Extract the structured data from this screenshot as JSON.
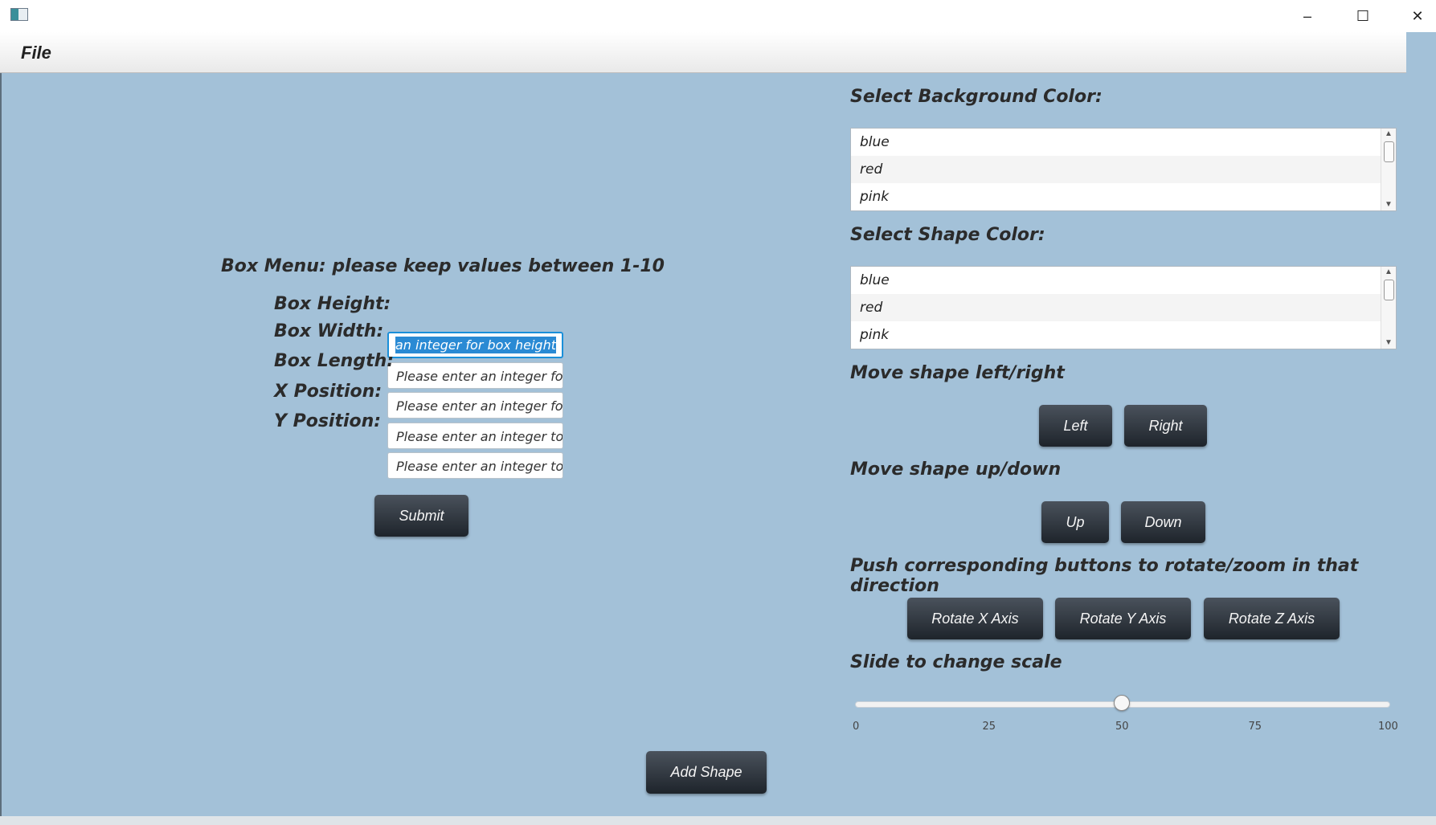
{
  "window": {
    "minimize": "–",
    "maximize": "☐",
    "close": "✕"
  },
  "menu": {
    "file": "File"
  },
  "box_menu": {
    "title": "Box Menu: please keep values between 1-10",
    "fields": [
      {
        "label": "Box Height:",
        "value": "an integer for box height"
      },
      {
        "label": "Box Width:",
        "value": "Please enter an integer fo."
      },
      {
        "label": "Box Length:",
        "value": "Please enter an integer fo."
      },
      {
        "label": "X Position:",
        "value": "Please enter an integer to"
      },
      {
        "label": "Y Position:",
        "value": "Please enter an integer to"
      }
    ],
    "submit": "Submit"
  },
  "add_shape": "Add Shape",
  "background_color": {
    "label": "Select Background Color:",
    "items": [
      "blue",
      "red",
      "pink"
    ]
  },
  "shape_color": {
    "label": "Select Shape Color:",
    "items": [
      "blue",
      "red",
      "pink"
    ]
  },
  "move_lr": {
    "label": "Move shape left/right",
    "left": "Left",
    "right": "Right"
  },
  "move_ud": {
    "label": "Move shape up/down",
    "up": "Up",
    "down": "Down"
  },
  "rotate": {
    "label": "Push corresponding buttons to rotate/zoom in that direction",
    "x": "Rotate X Axis",
    "y": "Rotate Y Axis",
    "z": "Rotate Z Axis"
  },
  "scale": {
    "label": "Slide to change scale",
    "min": 0,
    "max": 100,
    "value": 50,
    "ticks": [
      "0",
      "25",
      "50",
      "75",
      "100"
    ]
  },
  "colors": {
    "content_bg": "#a3c1d8",
    "button_dark": "#2a3038",
    "focus_blue": "#1a8fd9"
  }
}
